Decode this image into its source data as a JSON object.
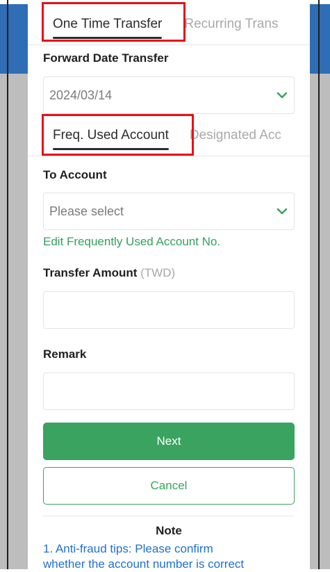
{
  "tabs_top": {
    "active": "One Time Transfer",
    "inactive": "Recurring Trans"
  },
  "forward_date": {
    "label": "Forward Date Transfer",
    "value": "2024/03/14"
  },
  "tabs_account": {
    "active": "Freq. Used Account",
    "inactive": "Designated Acc"
  },
  "to_account": {
    "label": "To Account",
    "placeholder": "Please select",
    "edit_link": "Edit Frequently Used Account No."
  },
  "transfer_amount": {
    "label": "Transfer Amount",
    "unit": "(TWD)",
    "value": ""
  },
  "remark": {
    "label": "Remark",
    "value": ""
  },
  "buttons": {
    "next": "Next",
    "cancel": "Cancel"
  },
  "note": {
    "title": "Note",
    "line1": "1. Anti-fraud tips: Please confirm",
    "line2": "whether the account number is correct"
  },
  "colors": {
    "accent": "#3aa35f",
    "highlight": "#e4101b",
    "link_blue": "#1f6fd0",
    "header_blue": "#2f6db5"
  },
  "icons": {
    "dropdown": "chevron-down-icon"
  }
}
